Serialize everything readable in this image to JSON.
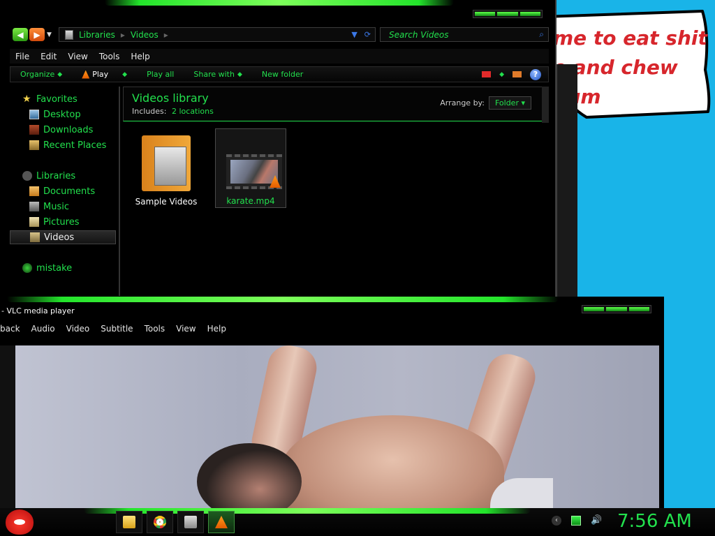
{
  "bubble": {
    "lines": "me to eat shit\ne and chew\n  um"
  },
  "explorer": {
    "breadcrumbs": [
      "Libraries",
      "Videos"
    ],
    "search_placeholder": "Search Videos",
    "menu": [
      "File",
      "Edit",
      "View",
      "Tools",
      "Help"
    ],
    "toolbar": {
      "organize": "Organize",
      "play": "Play",
      "play_all": "Play all",
      "share_with": "Share with",
      "new_folder": "New folder"
    },
    "nav": {
      "favorites": "Favorites",
      "desktop": "Desktop",
      "downloads": "Downloads",
      "recent_places": "Recent Places",
      "libraries": "Libraries",
      "documents": "Documents",
      "music": "Music",
      "pictures": "Pictures",
      "videos": "Videos",
      "mistake": "mistake"
    },
    "library": {
      "title": "Videos library",
      "includes_label": "Includes:",
      "includes_link": "2 locations",
      "arrange_label": "Arrange by:",
      "arrange_value": "Folder"
    },
    "files": [
      {
        "name": "Sample Videos",
        "type": "folder"
      },
      {
        "name": "karate.mp4",
        "type": "video"
      }
    ]
  },
  "vlc": {
    "title": "- VLC media player",
    "menu": [
      "back",
      "Audio",
      "Video",
      "Subtitle",
      "Tools",
      "View",
      "Help"
    ]
  },
  "taskbar": {
    "clock": "7:56 AM"
  },
  "colors": {
    "accent": "#22e04d",
    "desktop": "#19b4e8",
    "bubble_text": "#d7262c"
  }
}
